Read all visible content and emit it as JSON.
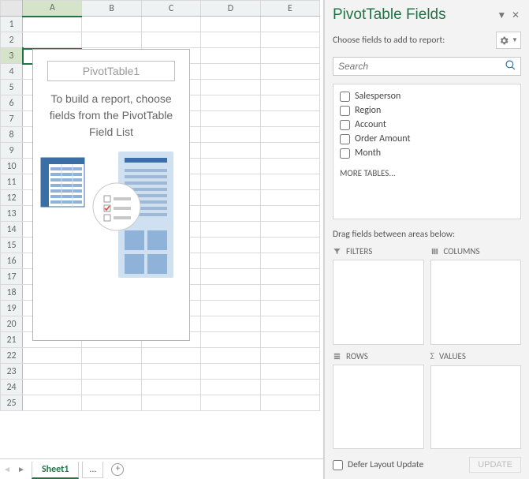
{
  "grid": {
    "columns": [
      "A",
      "B",
      "C",
      "D",
      "E"
    ],
    "row_count": 25,
    "selected_cell": "A3",
    "selected_col_index": 0,
    "selected_row_index": 2
  },
  "pivot_overlay": {
    "title": "PivotTable1",
    "hint": "To build a report, choose fields from the PivotTable Field List"
  },
  "tabbar": {
    "active_tab": "Sheet1",
    "tabs": [
      "Sheet1",
      "..."
    ]
  },
  "pane": {
    "title": "PivotTable Fields",
    "subtitle": "Choose fields to add to report:",
    "search_placeholder": "Search",
    "fields": [
      {
        "label": "Salesperson",
        "checked": false
      },
      {
        "label": "Region",
        "checked": false
      },
      {
        "label": "Account",
        "checked": false
      },
      {
        "label": "Order Amount",
        "checked": false
      },
      {
        "label": "Month",
        "checked": false
      }
    ],
    "more_tables": "MORE TABLES...",
    "drag_label": "Drag fields between areas below:",
    "areas": {
      "filters": "FILTERS",
      "columns": "COLUMNS",
      "rows": "ROWS",
      "values": "VALUES"
    },
    "defer_label": "Defer Layout Update",
    "update_label": "UPDATE"
  }
}
